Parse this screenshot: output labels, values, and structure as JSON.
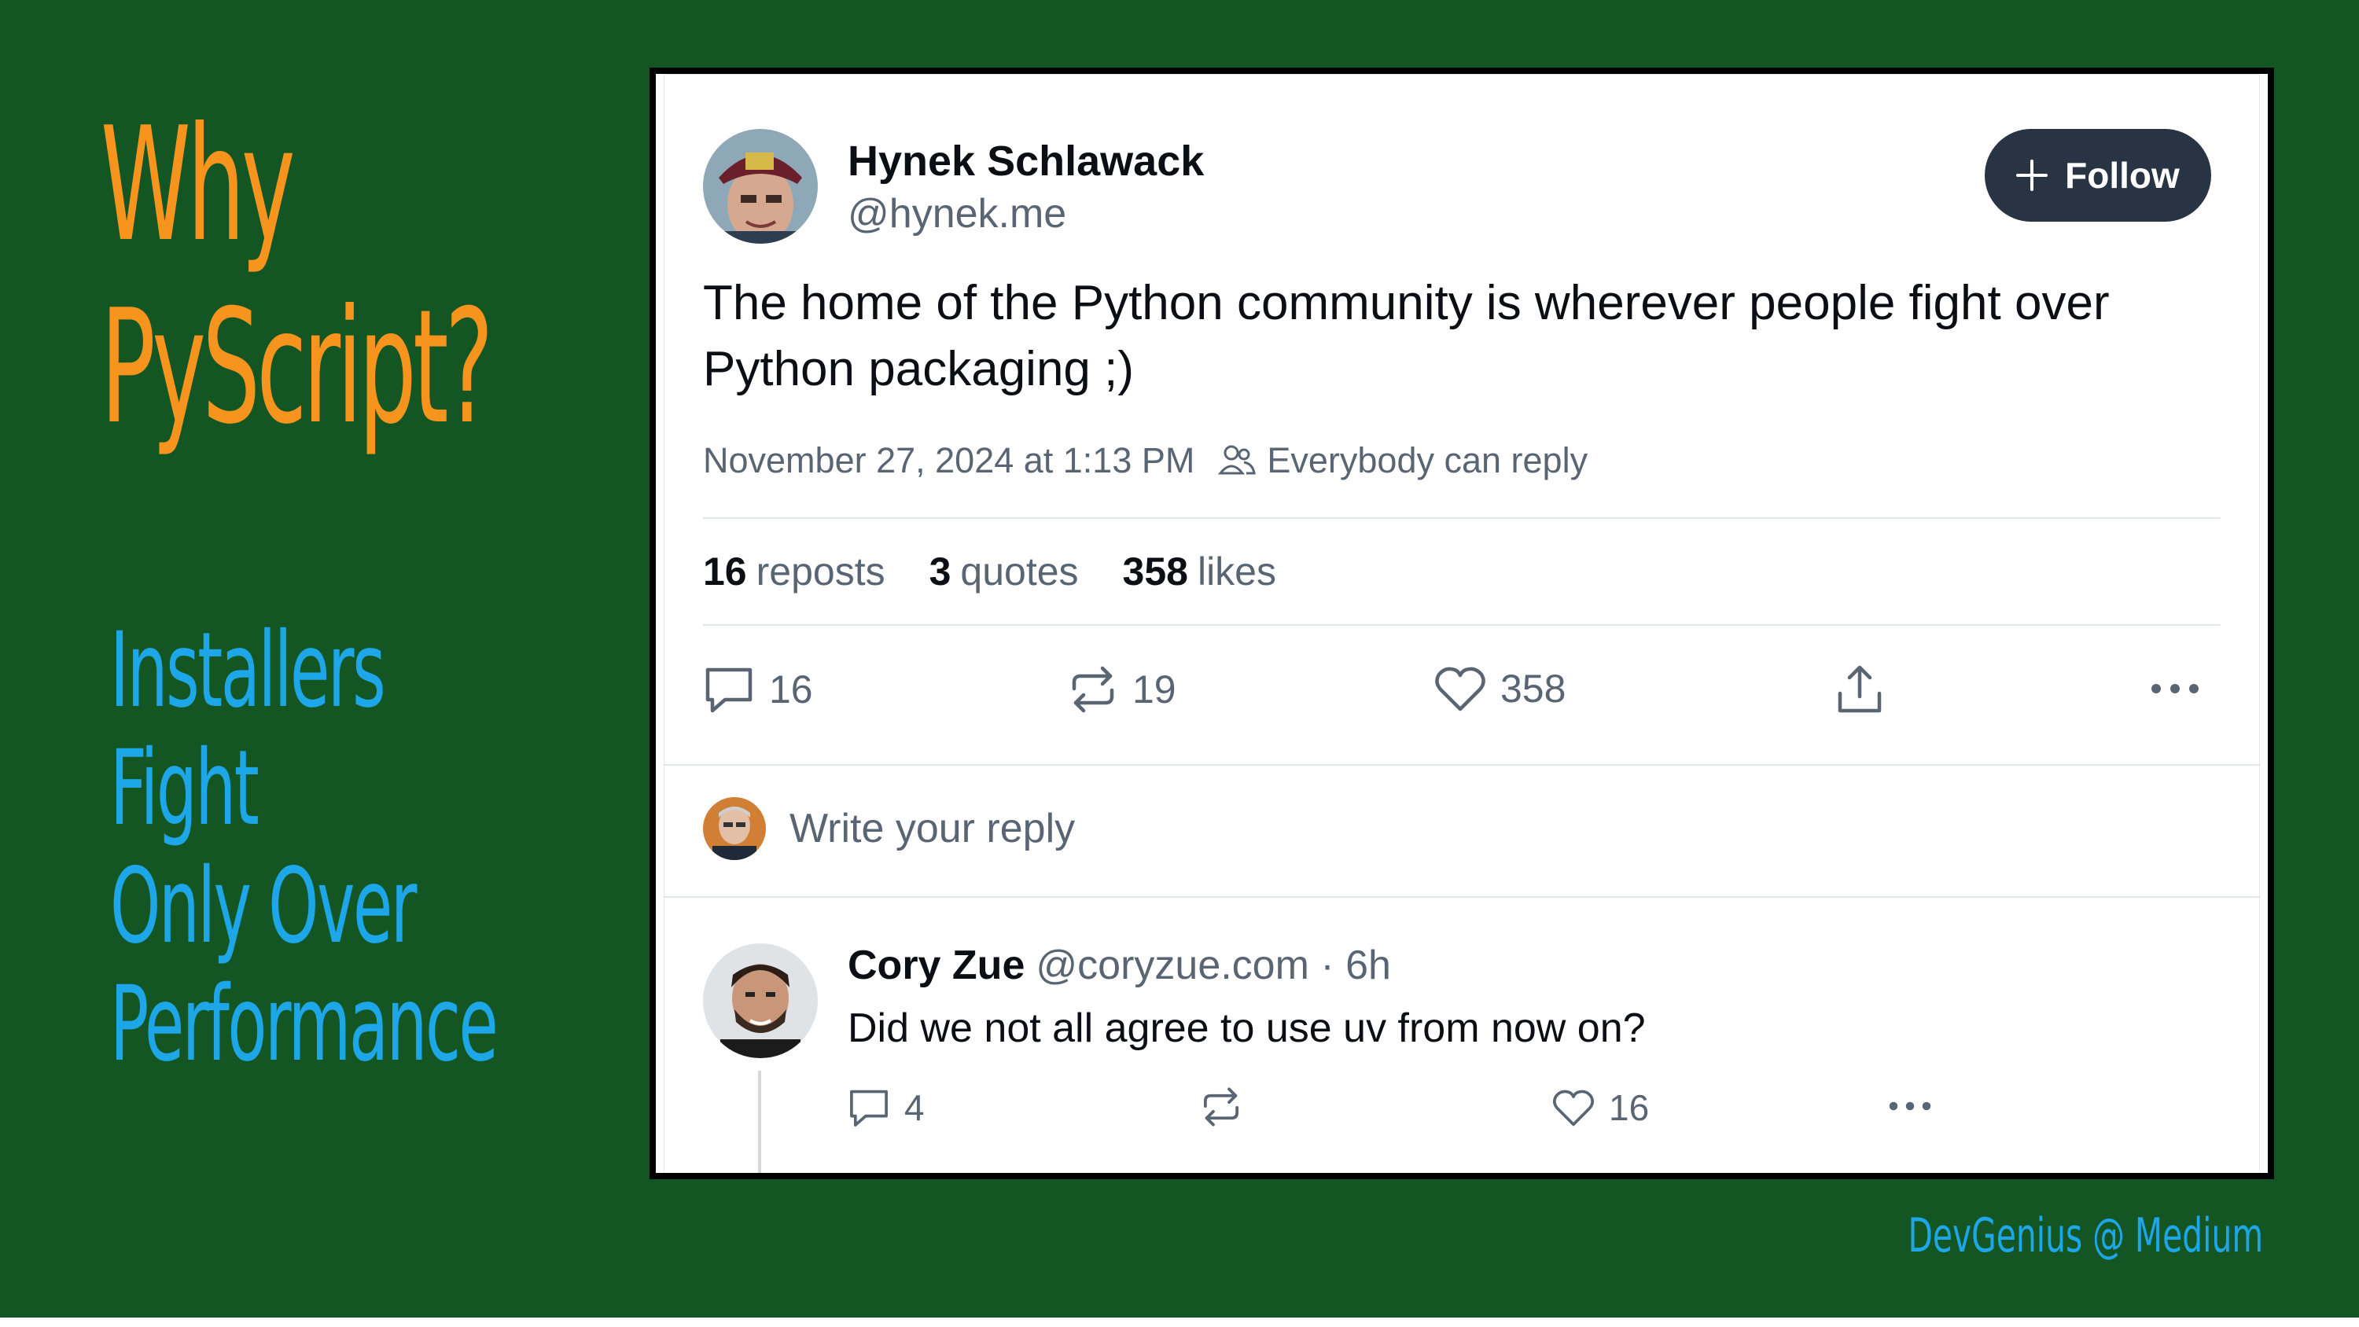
{
  "slide": {
    "title_line1": "Why",
    "title_line2": "PyScript?",
    "points": [
      "Installers",
      "Fight",
      "Only Over",
      "Performance"
    ],
    "credit": "DevGenius @ Medium",
    "colors": {
      "background": "#145623",
      "title": "#f7941d",
      "points": "#1ea7e8"
    }
  },
  "post": {
    "author": {
      "name": "Hynek Schlawack",
      "handle": "@hynek.me"
    },
    "follow_label": "Follow",
    "text": "The home of the Python community is wherever people fight over Python packaging ;)",
    "timestamp": "November 27, 2024 at 1:13 PM",
    "reply_permission": "Everybody can reply",
    "stats": {
      "reposts_count": "16",
      "reposts_label": "reposts",
      "quotes_count": "3",
      "quotes_label": "quotes",
      "likes_count": "358",
      "likes_label": "likes"
    },
    "actions": {
      "replies": "16",
      "reposts": "19",
      "likes": "358"
    },
    "reply_placeholder": "Write your reply"
  },
  "comment": {
    "author": "Cory Zue",
    "handle_time": "@coryzue.com · 6h",
    "text": "Did we not all agree to use uv from now on?",
    "actions": {
      "replies": "4",
      "likes": "16"
    }
  },
  "icons": [
    "plus-icon",
    "people-icon",
    "comment-icon",
    "repost-icon",
    "heart-icon",
    "share-icon",
    "more-icon"
  ]
}
